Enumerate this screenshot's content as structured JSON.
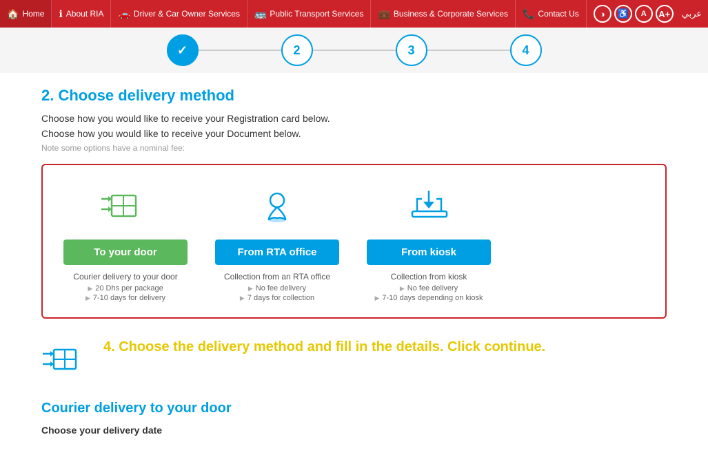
{
  "navbar": {
    "items": [
      {
        "id": "home",
        "label": "Home",
        "icon": "🏠"
      },
      {
        "id": "about-ria",
        "label": "About RIA",
        "icon": "ℹ"
      },
      {
        "id": "driver-car",
        "label": "Driver & Car Owner Services",
        "icon": "🚗"
      },
      {
        "id": "public-transport",
        "label": "Public Transport Services",
        "icon": "🚌"
      },
      {
        "id": "business-corporate",
        "label": "Business & Corporate Services",
        "icon": "💼"
      },
      {
        "id": "contact-us",
        "label": "Contact Us",
        "icon": "📞"
      }
    ],
    "accessibility": {
      "contrast_btn": "◑",
      "accessibility_btn": "♿",
      "font_normal": "A",
      "font_large": "A+",
      "arabic_label": "عربي"
    }
  },
  "steps": [
    {
      "number": "✓",
      "done": true
    },
    {
      "number": "2",
      "done": false
    },
    {
      "number": "3",
      "done": false
    },
    {
      "number": "4",
      "done": false
    }
  ],
  "section": {
    "title": "2. Choose delivery method",
    "desc1": "Choose how you would like to receive your Registration card below.",
    "desc2": "Choose how you would like to receive your Document below.",
    "note": "Note some options have a nominal fee:"
  },
  "delivery_options": [
    {
      "id": "to-your-door",
      "label": "To your door",
      "button_style": "active",
      "option_label": "Courier delivery to your door",
      "details": [
        "20 Dhs per package",
        "7-10 days for delivery"
      ]
    },
    {
      "id": "from-rta-office",
      "label": "From RTA office",
      "button_style": "outline",
      "option_label": "Collection from an RTA office",
      "details": [
        "No fee delivery",
        "7 days for collection"
      ]
    },
    {
      "id": "from-kiosk",
      "label": "From kiosk",
      "button_style": "outline",
      "option_label": "Collection from kiosk",
      "details": [
        "No fee delivery",
        "7-10 days depending on kiosk"
      ]
    }
  ],
  "instruction": {
    "text": "4. Choose the delivery method and fill in the details. Click continue."
  },
  "courier_section": {
    "title": "Courier delivery to your door",
    "subtitle": "Choose your delivery date"
  }
}
